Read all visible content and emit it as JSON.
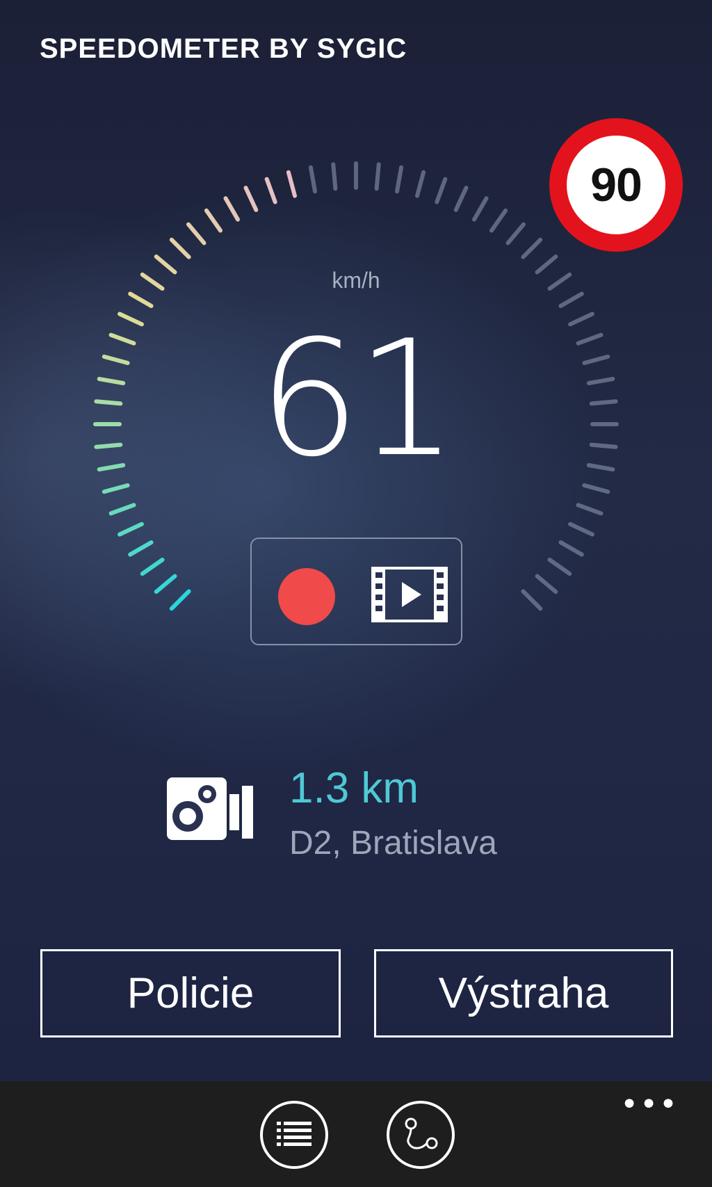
{
  "app": {
    "title": "SPEEDOMETER BY SYGIC"
  },
  "speed_limit": {
    "value": "90"
  },
  "speedometer": {
    "unit": "km/h",
    "speed": "61"
  },
  "record": {
    "record_icon": "record-dot-icon",
    "video_icon": "video-film-icon"
  },
  "speed_camera": {
    "icon": "speed-camera-icon",
    "distance": "1.3 km",
    "location": "D2, Bratislava"
  },
  "buttons": {
    "police": "Policie",
    "warning": "Výstraha"
  },
  "appbar": {
    "menu_icon": "list-icon",
    "route_icon": "route-icon",
    "more": "•••"
  },
  "colors": {
    "accent": "#4fc9d4",
    "record": "#f04a4a",
    "limit_ring": "#e3131d"
  }
}
